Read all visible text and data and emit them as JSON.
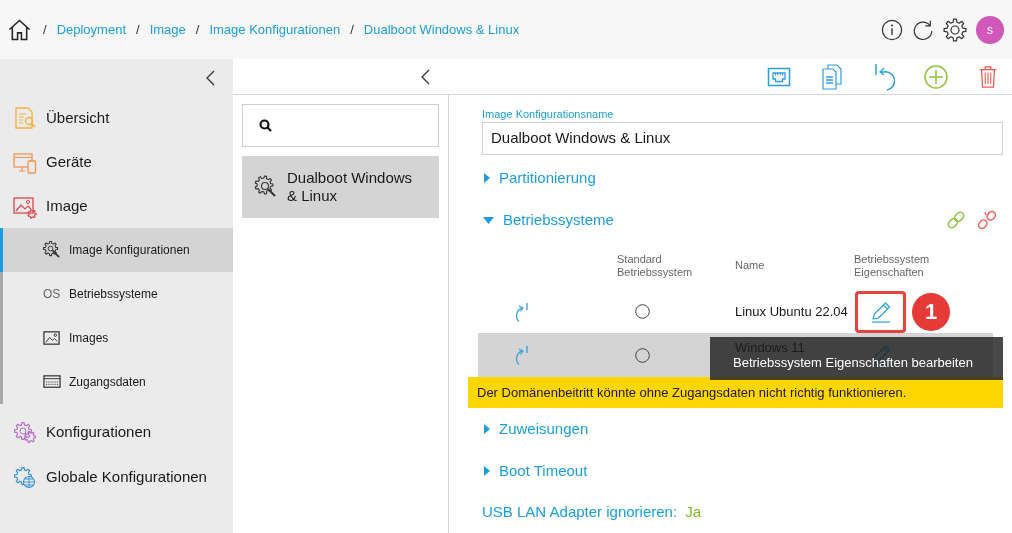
{
  "breadcrumbs": [
    {
      "separator": "/",
      "label": "Deployment"
    },
    {
      "separator": "/",
      "label": "Image"
    },
    {
      "separator": "/",
      "label": "Image Konfigurationen"
    },
    {
      "separator": "/",
      "label": "Dualboot Windows & Linux"
    }
  ],
  "user": {
    "initial": "s"
  },
  "sidebar": {
    "items": [
      {
        "label": "Übersicht",
        "selected": false
      },
      {
        "label": "Geräte",
        "selected": false
      },
      {
        "label": "Image",
        "selected": false,
        "children": [
          {
            "label": "Image Konfigurationen",
            "selected": true
          },
          {
            "label": "Betriebssysteme",
            "icon_text": "OS",
            "selected": false
          },
          {
            "label": "Images",
            "selected": false
          },
          {
            "label": "Zugangsdaten",
            "selected": false
          }
        ]
      },
      {
        "label": "Konfigurationen",
        "selected": false
      },
      {
        "label": "Globale Konfigurationen",
        "selected": false
      }
    ]
  },
  "list": {
    "items": [
      {
        "label": "Dualboot Windows & Linux",
        "selected": true
      }
    ]
  },
  "detail": {
    "name_field": {
      "label": "Image Konfigurationsname",
      "value": "Dualboot Windows & Linux"
    },
    "sections": [
      {
        "title": "Partitionierung",
        "expanded": false
      },
      {
        "title": "Betriebssysteme",
        "expanded": true,
        "table": {
          "columns": [
            "Standard Betriebssystem",
            "Name",
            "Betriebssystem Eigenschaften"
          ],
          "rows": [
            {
              "checked": false,
              "name": "Linux Ubuntu 22.04",
              "hovered": false,
              "highlighted": true,
              "callout": "1"
            },
            {
              "checked": false,
              "name": "Windows 11",
              "hovered": true,
              "highlighted": false
            }
          ]
        },
        "warning": "Der Domänenbeitritt könnte ohne Zugangsdaten nicht richtig funktionieren."
      },
      {
        "title": "Zuweisungen",
        "expanded": false
      },
      {
        "title": "Boot Timeout",
        "expanded": false
      }
    ],
    "usb_lan_adapter": {
      "label": "USB LAN Adapter ignorieren:",
      "value": "Ja"
    }
  },
  "tooltip": {
    "text": "Betriebssystem Eigenschaften bearbeiten"
  }
}
